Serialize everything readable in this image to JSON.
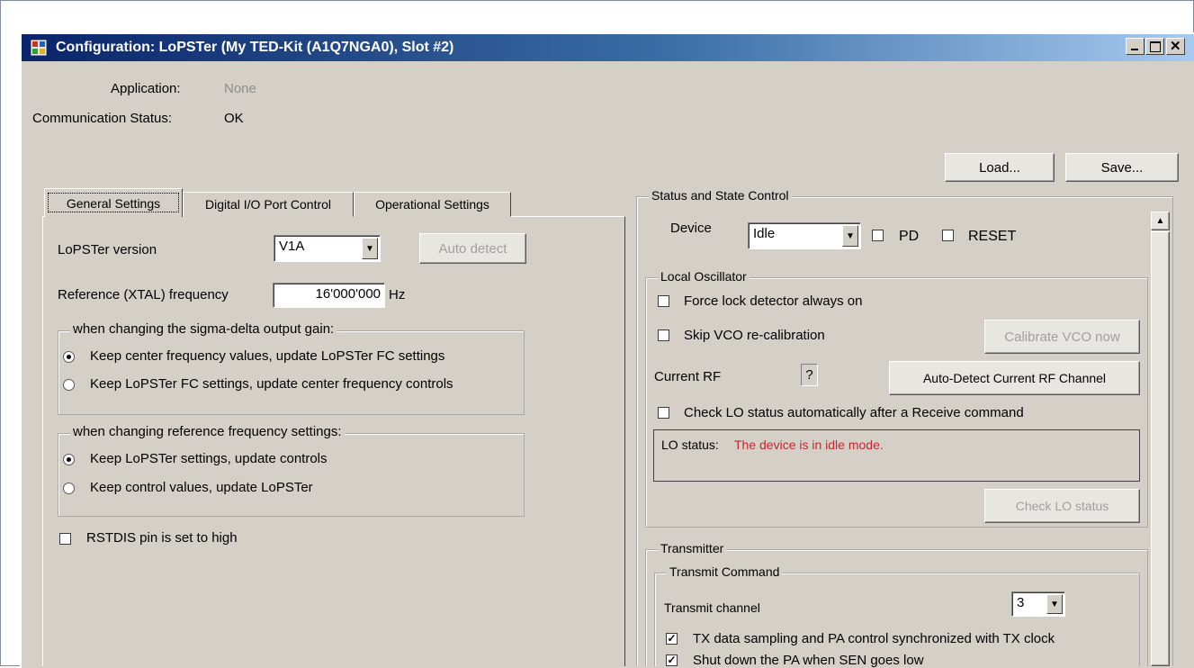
{
  "window": {
    "title": "Configuration: LoPSTer (My TED-Kit (A1Q7NGA0), Slot #2)",
    "controls": [
      "_",
      "□",
      "X"
    ]
  },
  "header": {
    "application_label": "Application:",
    "application_value": "None",
    "comm_status_label": "Communication Status:",
    "comm_status_value": "OK"
  },
  "toolbar": {
    "load_label": "Load...",
    "save_label": "Save..."
  },
  "tabs": [
    {
      "label": "General Settings",
      "selected": true
    },
    {
      "label": "Digital I/O Port Control",
      "selected": false
    },
    {
      "label": "Operational Settings",
      "selected": false
    }
  ],
  "general": {
    "version_label": "LoPSTer version",
    "version_value": "V1A",
    "auto_detect_label": "Auto detect",
    "ref_freq_label": "Reference (XTAL) frequency",
    "ref_freq_value": "16'000'000",
    "ref_freq_unit": "Hz",
    "sigma_group": {
      "title": "when changing the sigma-delta output gain:",
      "options": [
        {
          "label": "Keep center frequency values, update LoPSTer FC settings",
          "checked": true
        },
        {
          "label": "Keep LoPSTer FC settings, update center frequency controls",
          "checked": false
        }
      ]
    },
    "ref_group": {
      "title": "when changing reference frequency settings:",
      "options": [
        {
          "label": "Keep LoPSTer settings, update controls",
          "checked": true
        },
        {
          "label": "Keep control values, update LoPSTer",
          "checked": false
        }
      ]
    },
    "rstdis_label": "RSTDIS pin is set to high"
  },
  "status_control": {
    "title": "Status and State Control",
    "device_label": "Device",
    "device_value": "Idle",
    "pd_label": "PD",
    "reset_label": "RESET",
    "local_osc": {
      "title": "Local Oscillator",
      "force_lock_label": "Force lock detector always on",
      "skip_vco_label": "Skip VCO re-calibration",
      "calibrate_label": "Calibrate VCO now",
      "current_rf_label": "Current RF",
      "current_rf_value": "?",
      "auto_detect_rf_label": "Auto-Detect Current RF Channel",
      "check_lo_auto_label": "Check LO status automatically after a Receive command",
      "lo_status_label": "LO status:",
      "lo_status_value": "The device is in idle mode.",
      "check_lo_label": "Check LO status"
    },
    "transmitter": {
      "title": "Transmitter",
      "cmd_title": "Transmit Command",
      "channel_label": "Transmit channel",
      "channel_value": "3",
      "tx_sync_label": "TX data sampling and PA control synchronized with TX clock",
      "shutdown_label": "Shut down the PA when SEN goes low"
    }
  },
  "colors": {
    "status_error": "#c0282e",
    "title_gradient_start": "#0a246a"
  }
}
